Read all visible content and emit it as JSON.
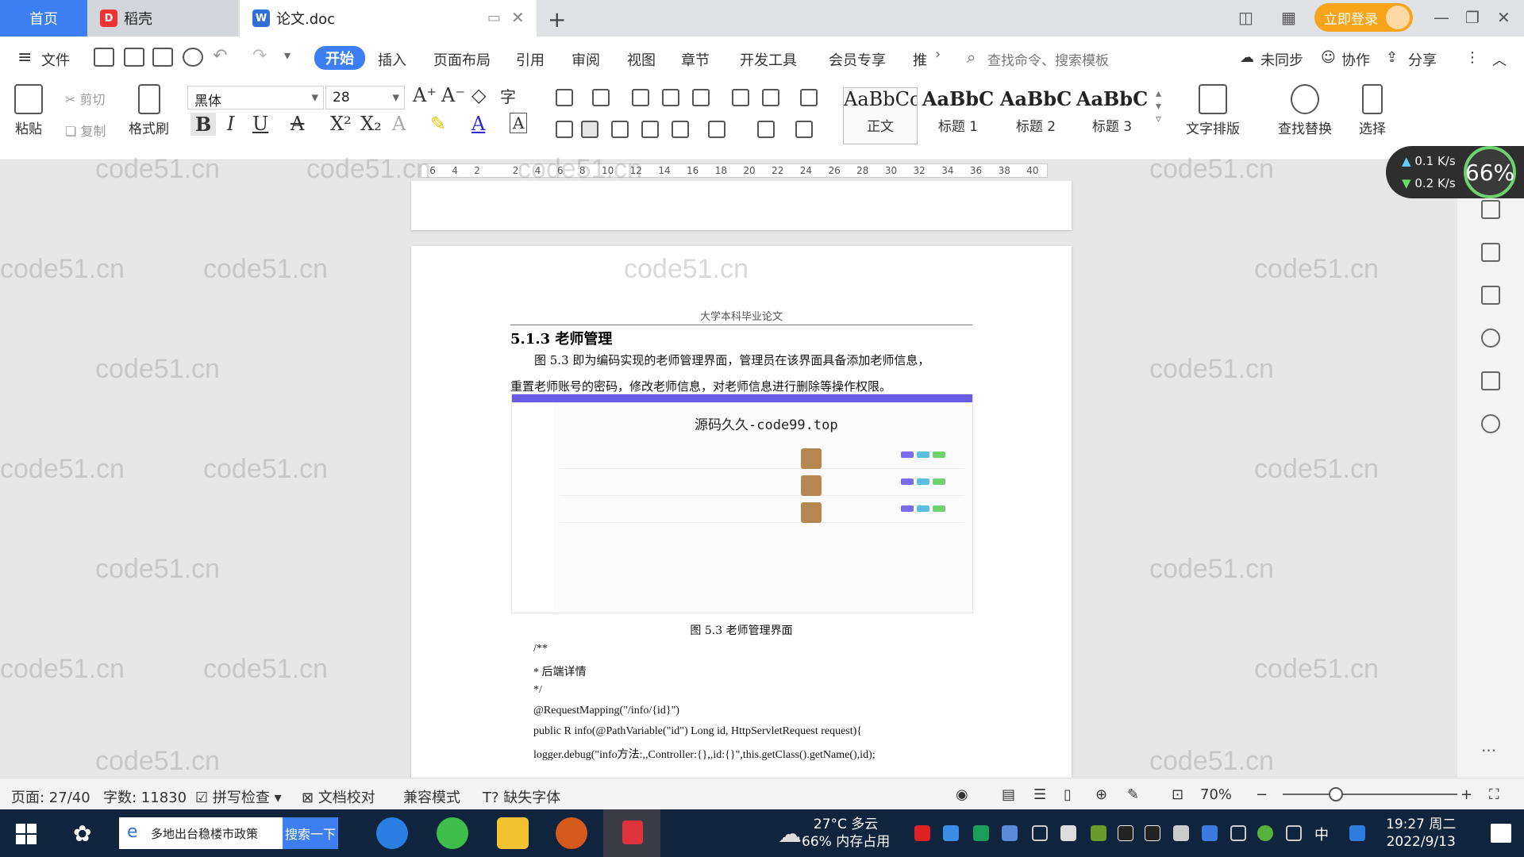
{
  "tabs": {
    "home": "首页",
    "daoke": "稻壳",
    "document": "论文.doc"
  },
  "titlebar": {
    "login": "立即登录"
  },
  "menu": {
    "file": "文件",
    "items": [
      "开始",
      "插入",
      "页面布局",
      "引用",
      "审阅",
      "视图",
      "章节",
      "开发工具",
      "会员专享",
      "推"
    ],
    "search_cmd": "查找命令、搜索模板",
    "unsync": "未同步",
    "collab": "协作",
    "share": "分享"
  },
  "ribbon": {
    "paste": "粘贴",
    "cut": "剪切",
    "copy": "复制",
    "format_painter": "格式刷",
    "font_name": "黑体",
    "font_size": "28",
    "styles": [
      {
        "sample": "AaBbCcI",
        "name": "正文"
      },
      {
        "sample": "AaBbC",
        "name": "标题 1"
      },
      {
        "sample": "AaBbC",
        "name": "标题 2"
      },
      {
        "sample": "AaBbC",
        "name": "标题 3"
      }
    ],
    "text_layout": "文字排版",
    "find_replace": "查找替换",
    "select": "选择"
  },
  "ruler": {
    "ticks": [
      "6",
      "4",
      "2",
      "",
      "2",
      "4",
      "6",
      "8",
      "10",
      "12",
      "14",
      "16",
      "18",
      "20",
      "22",
      "24",
      "26",
      "28",
      "30",
      "32",
      "34",
      "36",
      "38",
      "40"
    ]
  },
  "document": {
    "header": "大学本科毕业论文",
    "section_number": "5.1.3",
    "section_title": "老师管理",
    "para1": "图 5.3 即为编码实现的老师管理界面，管理员在该界面具备添加老师信息，",
    "para2": "重置老师账号的密码，修改老师信息，对老师信息进行删除等操作权限。",
    "figure_watermark": "源码久久-code99.top",
    "figure_caption": "图 5.3  老师管理界面",
    "code_lines": [
      "/**",
      "*  后端详情",
      "*/",
      "@RequestMapping(\"/info/{id}\")",
      "public R info(@PathVariable(\"id\") Long id, HttpServletRequest request){",
      "    logger.debug(\"info方法:,,Controller:{},,id:{}\",this.getClass().getName(),id);"
    ]
  },
  "watermark": "code51.cn",
  "network": {
    "up": "0.1 K/s",
    "down": "0.2 K/s",
    "percent": "66%"
  },
  "statusbar": {
    "page": "页面: 27/40",
    "words": "字数: 11830",
    "spell": "拼写检查",
    "proofread": "文档校对",
    "compat": "兼容模式",
    "missing_font": "缺失字体",
    "zoom": "70%"
  },
  "taskbar": {
    "search_text": "多地出台稳楼市政策",
    "search_btn": "搜索一下",
    "weather_line1": "27°C  多云",
    "weather_line2": "66%  内存占用",
    "ime": "中",
    "time": "19:27 周二",
    "date": "2022/9/13"
  },
  "colors": {
    "accent": "#3d7ff2",
    "login": "#f7a31c",
    "taskbar": "#10243e"
  }
}
